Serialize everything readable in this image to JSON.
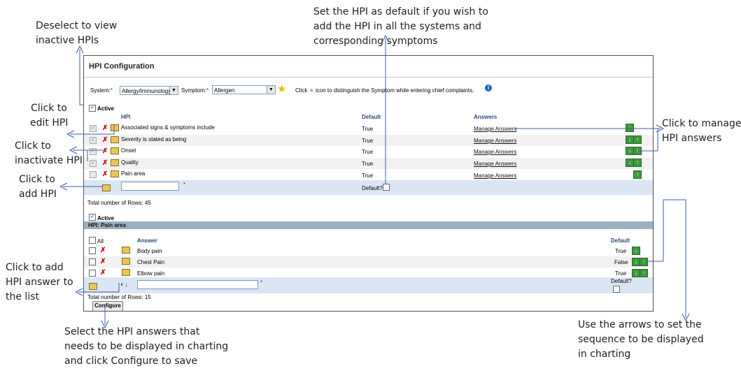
{
  "annotations": {
    "deselect": [
      "Deselect  to view",
      "inactive HPIs"
    ],
    "set_default": [
      "Set the HPI as default if you wish to",
      "add the HPI in all the systems and",
      "corresponding symptoms"
    ],
    "edit": [
      "Click to",
      "edit HPI"
    ],
    "inactivate": [
      "Click to",
      "inactivate HPI"
    ],
    "add_hpi": [
      "Click to",
      "add HPI"
    ],
    "manage": [
      "Click to manage",
      "HPI answers"
    ],
    "add_answer": [
      "Click to add",
      "HPI answer to",
      "the list"
    ],
    "select_answers": [
      "Select the HPI answers that",
      "needs to be displayed in charting",
      "and click Configure to save"
    ],
    "arrows": [
      "Use the arrows to set the",
      "sequence to be displayed",
      "in charting"
    ]
  },
  "panel": {
    "title": "HPI Configuration",
    "system_label": "System:",
    "system_value": "Allergy/Immunology",
    "symptom_label": "Symptom:",
    "symptom_value": "Allergen",
    "required_mark": "*",
    "hint_pre": "Click",
    "hint_post": "icon to distinguish the Symptom while entering chief complaints.",
    "active_label": "Active",
    "columns": {
      "hpi": "HPI",
      "default": "Default",
      "answers": "Answers"
    },
    "hpi_rows": [
      {
        "name": "Associated signs & symptoms include",
        "default": "True",
        "answers": "Manage Answers",
        "arrows": "down"
      },
      {
        "name": "Severity is stated as being",
        "default": "True",
        "answers": "Manage Answers",
        "arrows": "both"
      },
      {
        "name": "Onset",
        "default": "True",
        "answers": "Manage Answers",
        "arrows": "both"
      },
      {
        "name": "Quality",
        "default": "True",
        "answers": "Manage Answers",
        "arrows": "both"
      },
      {
        "name": "Pain area",
        "default": "True",
        "answers": "Manage Answers",
        "arrows": "up"
      }
    ],
    "default_q": "Default?",
    "total_rows_1": "Total number of Rows: 45",
    "active_label_2": "Active",
    "section_title": "HPI: Pain area",
    "ans_columns": {
      "all": "All",
      "answer": "Answer",
      "default": "Default"
    },
    "answer_rows": [
      {
        "name": "Body pain",
        "default": "True",
        "arrows": "down"
      },
      {
        "name": "Chest Pain",
        "default": "False",
        "arrows": "both"
      },
      {
        "name": "Elbow pain",
        "default": "True",
        "arrows": "up"
      }
    ],
    "default_q2": "Default?",
    "total_rows_2": "Total number of Rows: 15",
    "configure_label": "Configure"
  },
  "colors": {
    "line": "#3a5fa8",
    "header_text": "#2d4a7a",
    "add_row": "#dbe6f4",
    "section_bar": "#9cb0c0",
    "arrow_green": "#3a9a3a"
  },
  "icons": [
    "checkbox",
    "delete-x-icon",
    "edit-folder-icon",
    "star-icon",
    "info-icon",
    "arrow-down-icon",
    "arrow-up-icon",
    "add-folder-icon"
  ]
}
